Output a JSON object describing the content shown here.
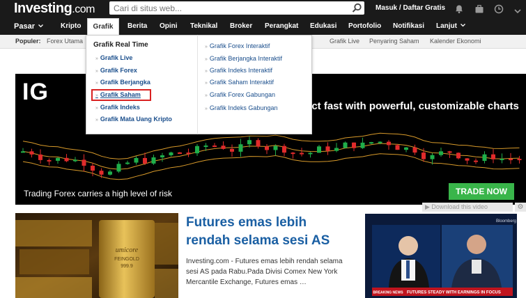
{
  "header": {
    "logo_main": "Investing",
    "logo_suffix": ".com",
    "search": {
      "placeholder": "Cari di situs web..."
    },
    "login_label": "Masuk / Daftar Gratis",
    "icons": [
      "bell-icon",
      "briefcase-icon",
      "clock-icon",
      "chevron-down-icon"
    ]
  },
  "nav": {
    "items": [
      "Pasar",
      "Kripto",
      "Grafik",
      "Berita",
      "Opini",
      "Teknikal",
      "Broker",
      "Perangkat",
      "Edukasi",
      "Portofolio",
      "Notifikasi",
      "Lanjut"
    ],
    "active": "Grafik"
  },
  "popular": {
    "label": "Populer:",
    "items": [
      "Forex Utama",
      "Grafik Live",
      "Penyaring Saham",
      "Kalender Ekonomi"
    ]
  },
  "dropdown": {
    "heading": "Grafik Real Time",
    "left_links": [
      "Grafik Live",
      "Grafik Forex",
      "Grafik Berjangka",
      "Grafik Saham",
      "Grafik Indeks",
      "Grafik Mata Uang Kripto"
    ],
    "right_links": [
      "Grafik Forex Interaktif",
      "Grafik Berjangka Interaktif",
      "Grafik Indeks Interaktif",
      "Grafik Saham Interaktif",
      "Grafik Forex Gabungan",
      "Grafik Indeks Gabungan"
    ],
    "highlighted": "Grafik Saham"
  },
  "ad": {
    "brand": "IG",
    "headline": "act fast with powerful, customizable charts",
    "risk": "Trading Forex carries a high level of risk",
    "cta": "TRADE NOW",
    "download_video": "Download this video"
  },
  "article": {
    "title": "Futures emas lebih rendah selama sesi AS",
    "body": "Investing.com - Futures emas lebih rendah selama sesi AS pada Rabu.Pada Divisi Comex New York Mercantile Exchange, Futures emas …",
    "image_text": {
      "brand": "umicore",
      "label": "FEINGOLD",
      "purity": "999.9"
    }
  },
  "video": {
    "network": "Bloomberg",
    "breaking": "BREAKING NEWS",
    "ticker": "FUTURES STEADY WITH EARNINGS IN FOCUS"
  },
  "colors": {
    "link": "#1a4e8c",
    "title": "#1a5fa3",
    "highlight": "#d92121",
    "cta": "#39b54a",
    "up": "#1fae4a",
    "down": "#e02b2b"
  }
}
